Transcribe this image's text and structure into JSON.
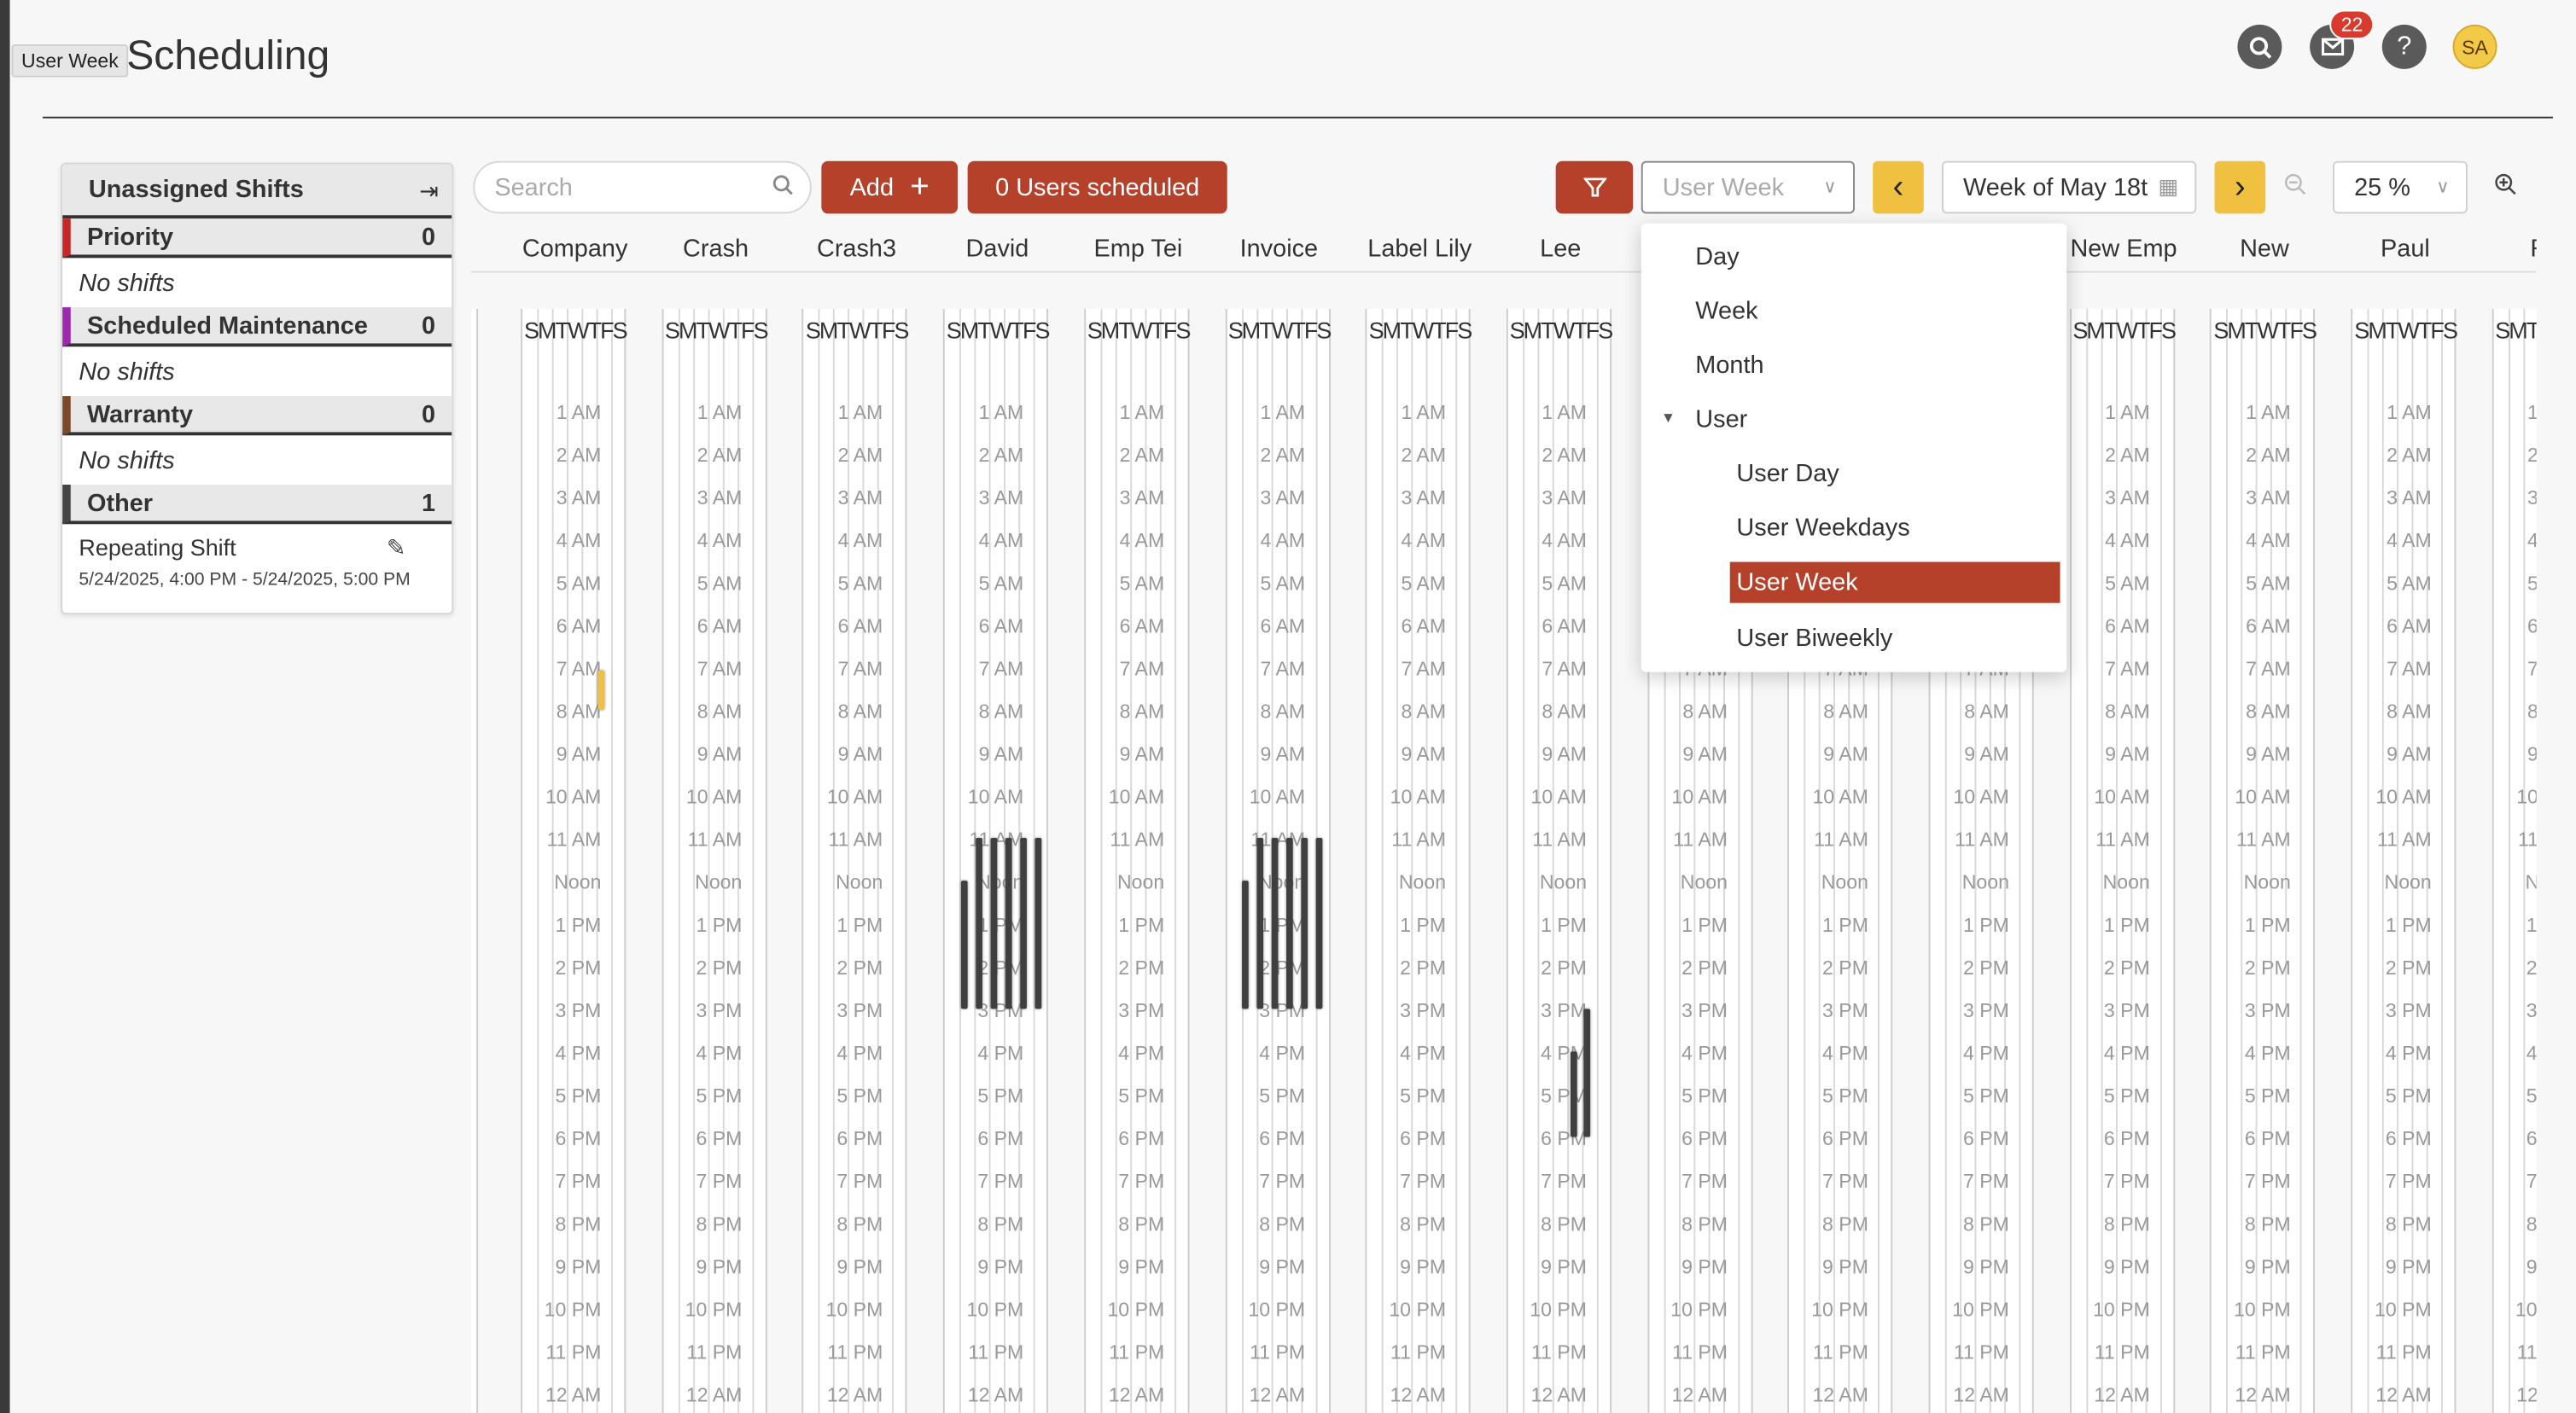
{
  "tooltip": "User Week",
  "page": {
    "title": "Scheduling"
  },
  "header": {
    "notification_count": "22",
    "avatar_initials": "SA"
  },
  "unassigned": {
    "title": "Unassigned Shifts",
    "categories": [
      {
        "name": "Priority",
        "count": "0",
        "color": "#c62828",
        "empty_text": "No shifts"
      },
      {
        "name": "Scheduled Maintenance",
        "count": "0",
        "color": "#9c27b0",
        "empty_text": "No shifts"
      },
      {
        "name": "Warranty",
        "count": "0",
        "color": "#7a4b2a",
        "empty_text": "No shifts"
      },
      {
        "name": "Other",
        "count": "1",
        "color": "#444444"
      }
    ],
    "shift": {
      "name": "Repeating Shift",
      "time": "5/24/2025, 4:00 PM - 5/24/2025, 5:00 PM"
    }
  },
  "toolbar": {
    "search_placeholder": "Search",
    "add_label": "Add",
    "scheduled_label": "0 Users scheduled",
    "view_value": "User Week",
    "week_label": "Week of May 18t",
    "zoom_value": "25 %"
  },
  "view_menu": {
    "items": [
      "Day",
      "Week",
      "Month",
      "User",
      "User Day",
      "User Weekdays",
      "User Week",
      "User Biweekly"
    ],
    "selected": "User Week"
  },
  "grid": {
    "users": [
      "Company",
      "Crash",
      "Crash3",
      "David",
      "Emp Tei",
      "Invoice",
      "Label Lily",
      "Lee",
      "",
      "",
      "",
      "New Emp",
      "New",
      "Paul",
      "Ro"
    ],
    "day_letters": "SMTWTFS",
    "hours": [
      "1 AM",
      "2 AM",
      "3 AM",
      "4 AM",
      "5 AM",
      "6 AM",
      "7 AM",
      "8 AM",
      "9 AM",
      "10 AM",
      "11 AM",
      "Noon",
      "1 PM",
      "2 PM",
      "3 PM",
      "4 PM",
      "5 PM",
      "6 PM",
      "7 PM",
      "8 PM",
      "9 PM",
      "10 PM",
      "11 PM",
      "12 AM"
    ]
  },
  "colors": {
    "accent": "#b5412a",
    "yellow": "#f0c040",
    "dark": "#3f3f3f"
  }
}
